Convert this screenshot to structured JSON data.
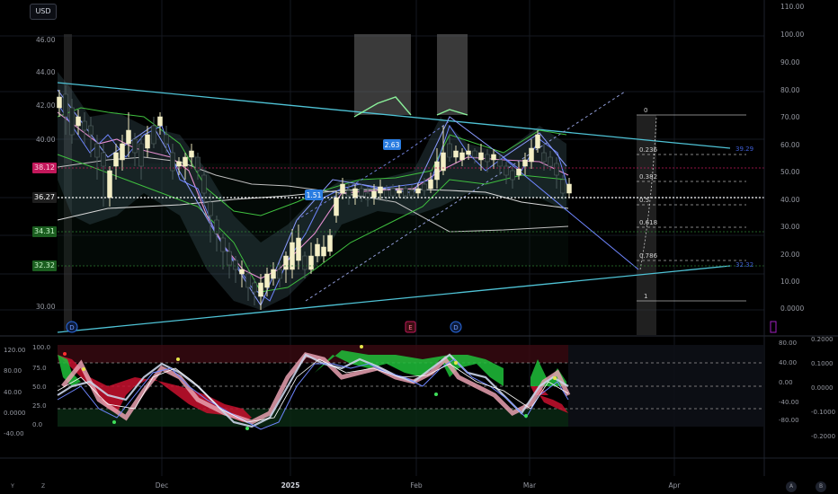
{
  "currency": "USD",
  "colors": {
    "background": "#000000",
    "channel": "#4fc3d6",
    "candle_up": "#f4efc6",
    "candle_down": "#2a3a3a",
    "ma_white": "#d8d8d8",
    "green_line": "#3fbf3f",
    "pink_line": "#e58fd0",
    "blue_line": "#6f86ff",
    "fib_line": "#b0b0b0",
    "osc_red": "#c8102e",
    "osc_green": "#1fbf3a"
  },
  "price_axis_left": [
    "46.00",
    "44.00",
    "42.00",
    "40.00",
    "36.00",
    "32.00",
    "30.00"
  ],
  "price_labels": [
    {
      "text": "38.12",
      "color": "#c2185b",
      "value": 38.12
    },
    {
      "text": "36.27",
      "color": "#1e1e1e",
      "value": 36.27
    },
    {
      "text": "34.31",
      "color": "#1b5e20",
      "value": 34.31
    },
    {
      "text": "32.32",
      "color": "#1b5e20",
      "value": 32.32
    }
  ],
  "right_axis": [
    "110.00",
    "100.00",
    "90.00",
    "80.00",
    "70.00",
    "60.00",
    "50.00",
    "40.00",
    "30.00",
    "20.00",
    "10.00",
    "0.0000"
  ],
  "fib_levels": [
    "0",
    "0.236",
    "0.382",
    "0.5",
    "0.618",
    "0.786",
    "1"
  ],
  "channel_labels": [
    "39.29",
    "32.32"
  ],
  "swing_labels": [
    "1.51",
    "2.63"
  ],
  "event_markers": [
    "D",
    "E",
    "D"
  ],
  "osc_left_axis": [
    "120.00",
    "80.00",
    "40.00",
    "0.0000",
    "-40.00"
  ],
  "osc_left_axis2": [
    "100.0",
    "75.0",
    "50.0",
    "25.0",
    "0.0"
  ],
  "osc_right_axis": [
    "80.00",
    "40.00",
    "0.00",
    "-40.00",
    "-80.00"
  ],
  "osc_right_axis2": [
    "0.2000",
    "0.1000",
    "0.0000",
    "-0.1000",
    "-0.2000"
  ],
  "time_axis": [
    "Dec",
    "2025",
    "Feb",
    "Mar",
    "Apr"
  ],
  "bottom_corners": [
    "Y",
    "Z",
    "A",
    "B"
  ]
}
